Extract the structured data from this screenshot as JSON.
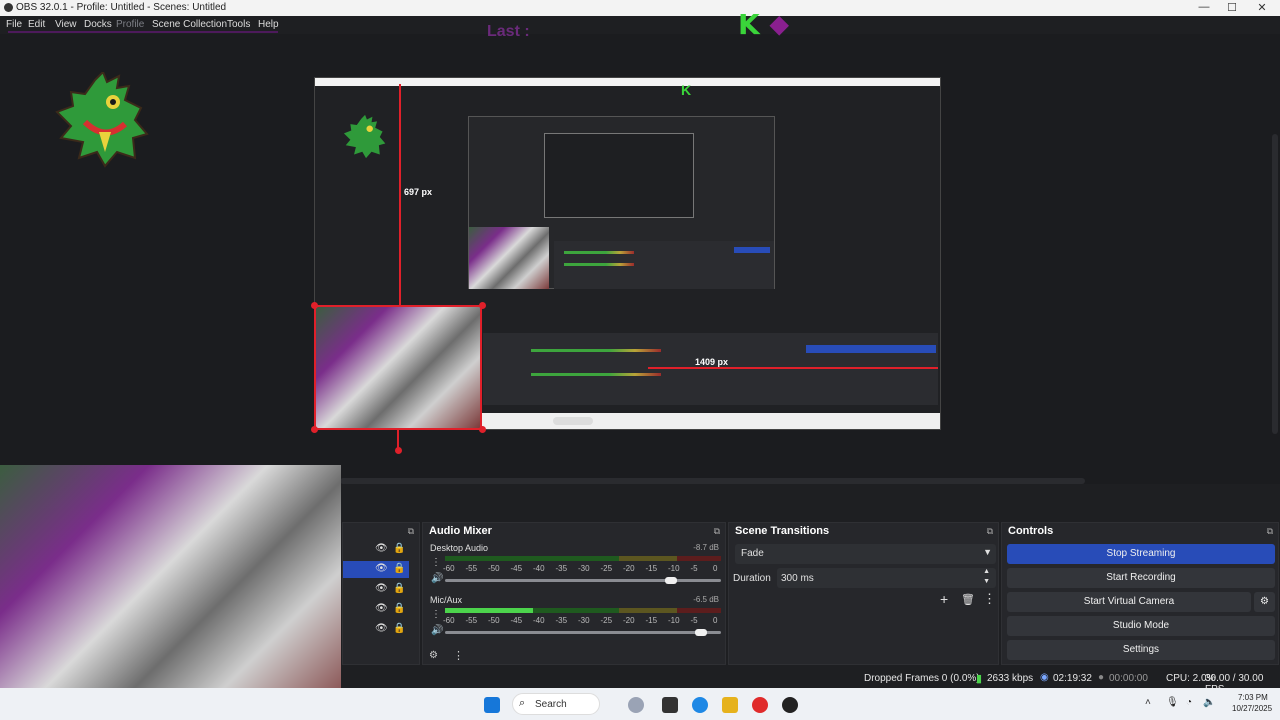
{
  "window": {
    "title": "OBS 32.0.1 - Profile: Untitled - Scenes: Untitled",
    "controls": [
      "—",
      "☐",
      "✕"
    ]
  },
  "menu": [
    "File",
    "Edit",
    "View",
    "Docks",
    "Profile",
    "Scene Collection",
    "Tools",
    "Help"
  ],
  "preview": {
    "overlay_text": "Last :",
    "height_label": "697 px",
    "width_label": "1409 px"
  },
  "audio_mixer": {
    "title": "Audio Mixer",
    "channels": [
      {
        "name": "Desktop Audio",
        "db": "-8.7 dB",
        "level": 0.0,
        "volume": 0.84
      },
      {
        "name": "Mic/Aux",
        "db": "-6.5 dB",
        "level": 0.32,
        "volume": 0.95
      }
    ],
    "scale": [
      "-60",
      "-55",
      "-50",
      "-45",
      "-40",
      "-35",
      "-30",
      "-25",
      "-20",
      "-15",
      "-10",
      "-5",
      "0"
    ]
  },
  "scene_transitions": {
    "title": "Scene Transitions",
    "transition": "Fade",
    "duration_label": "Duration",
    "duration_value": "300 ms"
  },
  "controls": {
    "title": "Controls",
    "buttons": [
      "Stop Streaming",
      "Start Recording",
      "Start Virtual Camera",
      "Studio Mode",
      "Settings"
    ]
  },
  "status": {
    "dropped": "Dropped Frames 0 (0.0%)",
    "bitrate": "2633 kbps",
    "stream_time": "02:19:32",
    "rec_time": "00:00:00",
    "cpu": "CPU: 2.0%",
    "fps": "30.00 / 30.00 FPS"
  },
  "taskbar": {
    "search_placeholder": "Search",
    "time": "7:03 PM",
    "date": "10/27/2025"
  },
  "colors": {
    "accent": "#284cb8",
    "selection": "#e0202a"
  }
}
